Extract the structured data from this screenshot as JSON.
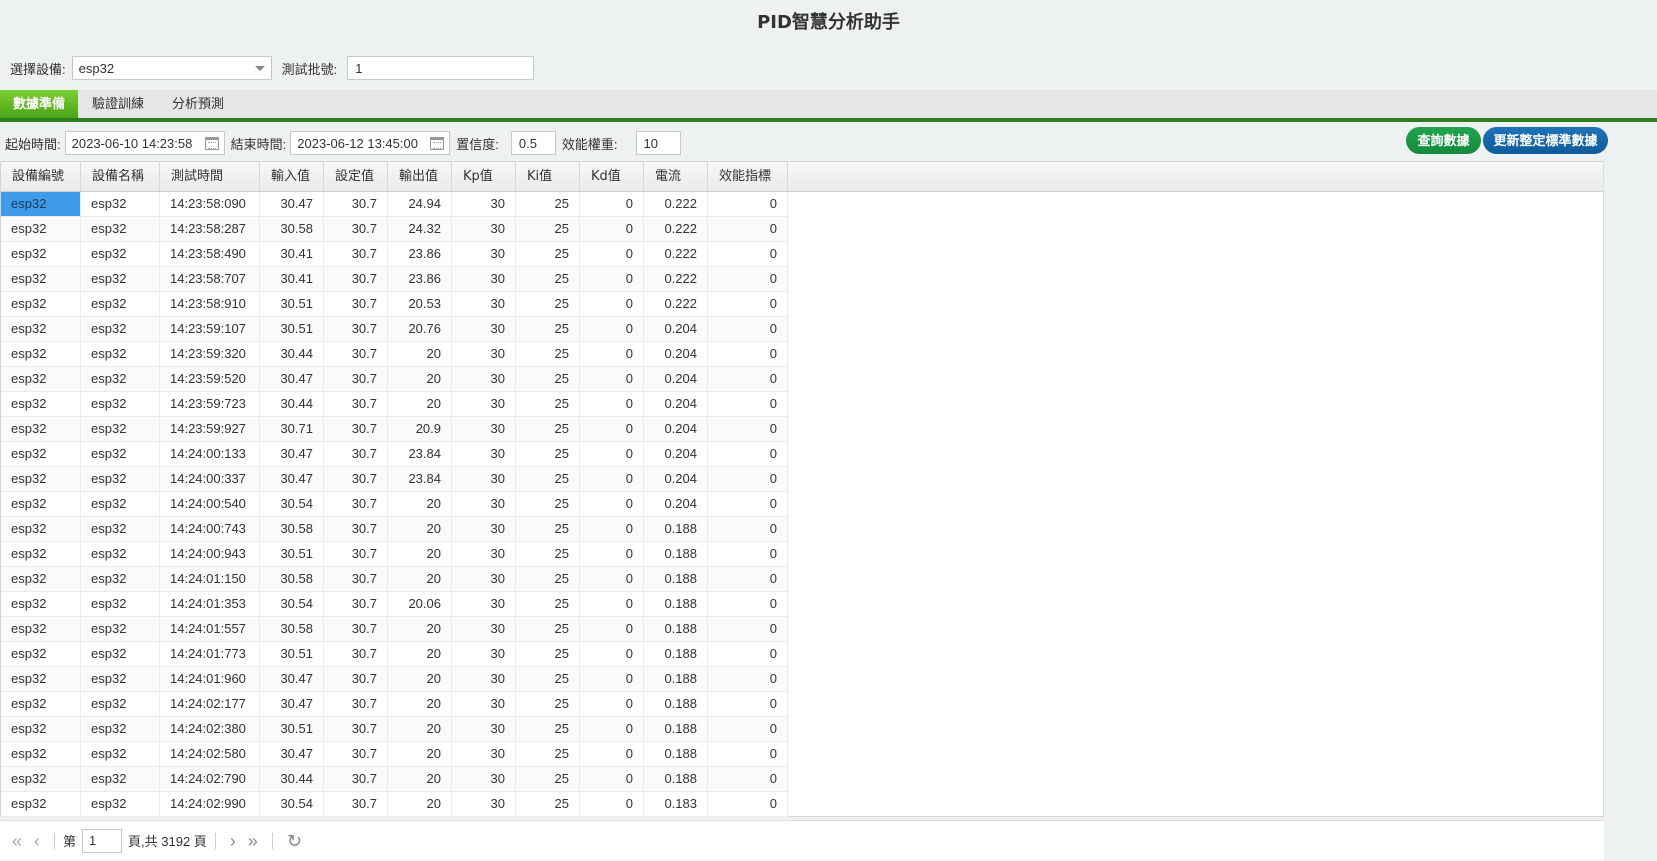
{
  "app_title": "PID智慧分析助手",
  "filters": {
    "device_label": "選擇設備:",
    "device_value": "esp32",
    "batch_label": "測試批號:",
    "batch_value": "1"
  },
  "tabs": [
    {
      "label": "數據準備",
      "active": true
    },
    {
      "label": "驗證訓練",
      "active": false
    },
    {
      "label": "分析預測",
      "active": false
    }
  ],
  "query": {
    "start_label": "起始時間:",
    "start_value": "2023-06-10 14:23:58",
    "end_label": "結束時間:",
    "end_value": "2023-06-12 13:45:00",
    "confidence_label": "置信度:",
    "confidence_value": "0.5",
    "weight_label": "效能權重:",
    "weight_value": "10",
    "query_button": "查詢數據",
    "update_button": "更新整定標準數據"
  },
  "grid": {
    "columns": [
      "設備編號",
      "設備名稱",
      "測試時間",
      "輸入值",
      "設定值",
      "輸出值",
      "Kp值",
      "Ki值",
      "Kd值",
      "電流",
      "效能指標"
    ],
    "rows": [
      [
        "esp32",
        "esp32",
        "14:23:58:090",
        "30.47",
        "30.7",
        "24.94",
        "30",
        "25",
        "0",
        "0.222",
        "0"
      ],
      [
        "esp32",
        "esp32",
        "14:23:58:287",
        "30.58",
        "30.7",
        "24.32",
        "30",
        "25",
        "0",
        "0.222",
        "0"
      ],
      [
        "esp32",
        "esp32",
        "14:23:58:490",
        "30.41",
        "30.7",
        "23.86",
        "30",
        "25",
        "0",
        "0.222",
        "0"
      ],
      [
        "esp32",
        "esp32",
        "14:23:58:707",
        "30.41",
        "30.7",
        "23.86",
        "30",
        "25",
        "0",
        "0.222",
        "0"
      ],
      [
        "esp32",
        "esp32",
        "14:23:58:910",
        "30.51",
        "30.7",
        "20.53",
        "30",
        "25",
        "0",
        "0.222",
        "0"
      ],
      [
        "esp32",
        "esp32",
        "14:23:59:107",
        "30.51",
        "30.7",
        "20.76",
        "30",
        "25",
        "0",
        "0.204",
        "0"
      ],
      [
        "esp32",
        "esp32",
        "14:23:59:320",
        "30.44",
        "30.7",
        "20",
        "30",
        "25",
        "0",
        "0.204",
        "0"
      ],
      [
        "esp32",
        "esp32",
        "14:23:59:520",
        "30.47",
        "30.7",
        "20",
        "30",
        "25",
        "0",
        "0.204",
        "0"
      ],
      [
        "esp32",
        "esp32",
        "14:23:59:723",
        "30.44",
        "30.7",
        "20",
        "30",
        "25",
        "0",
        "0.204",
        "0"
      ],
      [
        "esp32",
        "esp32",
        "14:23:59:927",
        "30.71",
        "30.7",
        "20.9",
        "30",
        "25",
        "0",
        "0.204",
        "0"
      ],
      [
        "esp32",
        "esp32",
        "14:24:00:133",
        "30.47",
        "30.7",
        "23.84",
        "30",
        "25",
        "0",
        "0.204",
        "0"
      ],
      [
        "esp32",
        "esp32",
        "14:24:00:337",
        "30.47",
        "30.7",
        "23.84",
        "30",
        "25",
        "0",
        "0.204",
        "0"
      ],
      [
        "esp32",
        "esp32",
        "14:24:00:540",
        "30.54",
        "30.7",
        "20",
        "30",
        "25",
        "0",
        "0.204",
        "0"
      ],
      [
        "esp32",
        "esp32",
        "14:24:00:743",
        "30.58",
        "30.7",
        "20",
        "30",
        "25",
        "0",
        "0.188",
        "0"
      ],
      [
        "esp32",
        "esp32",
        "14:24:00:943",
        "30.51",
        "30.7",
        "20",
        "30",
        "25",
        "0",
        "0.188",
        "0"
      ],
      [
        "esp32",
        "esp32",
        "14:24:01:150",
        "30.58",
        "30.7",
        "20",
        "30",
        "25",
        "0",
        "0.188",
        "0"
      ],
      [
        "esp32",
        "esp32",
        "14:24:01:353",
        "30.54",
        "30.7",
        "20.06",
        "30",
        "25",
        "0",
        "0.188",
        "0"
      ],
      [
        "esp32",
        "esp32",
        "14:24:01:557",
        "30.58",
        "30.7",
        "20",
        "30",
        "25",
        "0",
        "0.188",
        "0"
      ],
      [
        "esp32",
        "esp32",
        "14:24:01:773",
        "30.51",
        "30.7",
        "20",
        "30",
        "25",
        "0",
        "0.188",
        "0"
      ],
      [
        "esp32",
        "esp32",
        "14:24:01:960",
        "30.47",
        "30.7",
        "20",
        "30",
        "25",
        "0",
        "0.188",
        "0"
      ],
      [
        "esp32",
        "esp32",
        "14:24:02:177",
        "30.47",
        "30.7",
        "20",
        "30",
        "25",
        "0",
        "0.188",
        "0"
      ],
      [
        "esp32",
        "esp32",
        "14:24:02:380",
        "30.51",
        "30.7",
        "20",
        "30",
        "25",
        "0",
        "0.188",
        "0"
      ],
      [
        "esp32",
        "esp32",
        "14:24:02:580",
        "30.47",
        "30.7",
        "20",
        "30",
        "25",
        "0",
        "0.188",
        "0"
      ],
      [
        "esp32",
        "esp32",
        "14:24:02:790",
        "30.44",
        "30.7",
        "20",
        "30",
        "25",
        "0",
        "0.188",
        "0"
      ],
      [
        "esp32",
        "esp32",
        "14:24:02:990",
        "30.54",
        "30.7",
        "20",
        "30",
        "25",
        "0",
        "0.183",
        "0"
      ]
    ]
  },
  "pager": {
    "page_prefix": "第",
    "page_value": "1",
    "page_suffix": "頁,共 3192 頁",
    "icons": {
      "first": "double-chevron-left-icon",
      "prev": "chevron-left-icon",
      "next": "chevron-right-icon",
      "last": "double-chevron-right-icon",
      "refresh": "refresh-icon"
    }
  }
}
